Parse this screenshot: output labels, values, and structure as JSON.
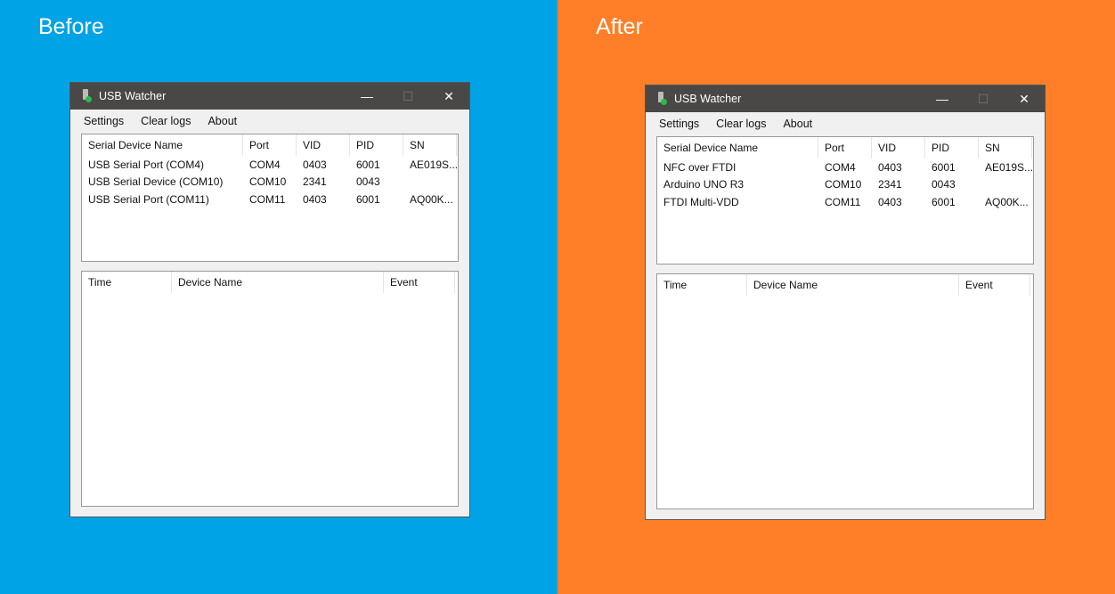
{
  "colors": {
    "before_bg": "#00a3e5",
    "after_bg": "#fe7f27",
    "titlebar": "#4a4846"
  },
  "panels": [
    {
      "label": "Before"
    },
    {
      "label": "After"
    }
  ],
  "windows": [
    {
      "title": "USB Watcher",
      "controls": {
        "minimize": "—",
        "maximize": "☐",
        "close": "✕"
      },
      "menu": [
        "Settings",
        "Clear logs",
        "About"
      ],
      "devices": {
        "columns": [
          "Serial Device Name",
          "Port",
          "VID",
          "PID",
          "SN"
        ],
        "rows": [
          [
            "USB Serial Port (COM4)",
            "COM4",
            "0403",
            "6001",
            "AE019S..."
          ],
          [
            "USB Serial Device (COM10)",
            "COM10",
            "2341",
            "0043",
            ""
          ],
          [
            "USB Serial Port (COM11)",
            "COM11",
            "0403",
            "6001",
            "AQ00K..."
          ]
        ]
      },
      "log": {
        "columns": [
          "Time",
          "Device Name",
          "Event"
        ]
      }
    },
    {
      "title": "USB Watcher",
      "controls": {
        "minimize": "—",
        "maximize": "☐",
        "close": "✕"
      },
      "menu": [
        "Settings",
        "Clear logs",
        "About"
      ],
      "devices": {
        "columns": [
          "Serial Device Name",
          "Port",
          "VID",
          "PID",
          "SN"
        ],
        "rows": [
          [
            "NFC over FTDI",
            "COM4",
            "0403",
            "6001",
            "AE019S..."
          ],
          [
            "Arduino UNO R3",
            "COM10",
            "2341",
            "0043",
            ""
          ],
          [
            "FTDI Multi-VDD",
            "COM11",
            "0403",
            "6001",
            "AQ00K..."
          ]
        ]
      },
      "log": {
        "columns": [
          "Time",
          "Device Name",
          "Event"
        ]
      }
    }
  ]
}
